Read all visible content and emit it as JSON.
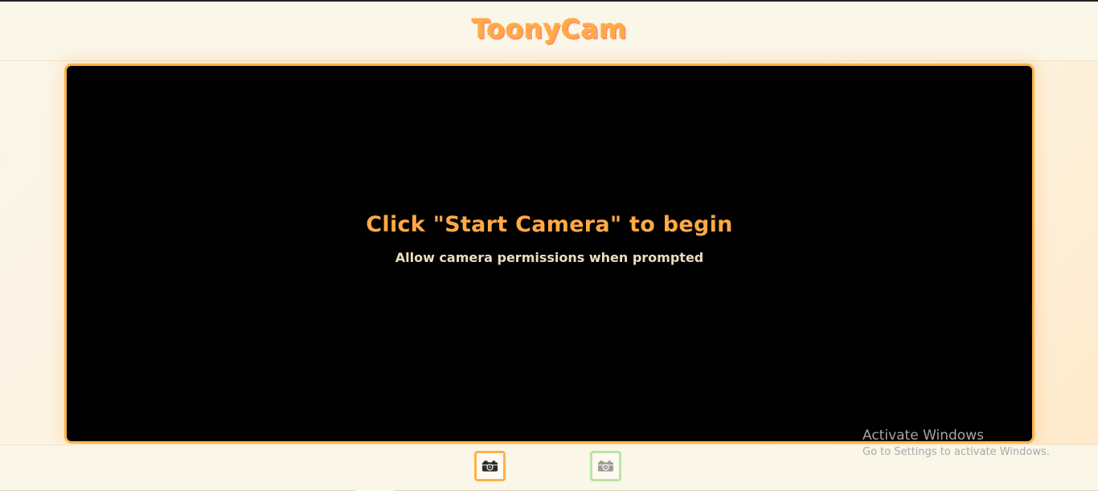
{
  "app": {
    "title": "ToonyCam"
  },
  "camera_view": {
    "state": "idle",
    "prompt_title": "Click \"Start Camera\" to begin",
    "prompt_subtitle": "Allow camera permissions when prompted"
  },
  "controls": {
    "start_camera_icon": "camera-icon",
    "capture_icon": "camera-icon",
    "capture_disabled": true
  },
  "os_overlay": {
    "title": "Activate Windows",
    "subtitle": "Go to Settings to activate Windows."
  },
  "colors": {
    "accent": "#ffaa45",
    "frame_border": "#ffb24a",
    "capture_border": "#b8e6a4",
    "background": "#faf6e8",
    "stage_background": "#000000"
  }
}
